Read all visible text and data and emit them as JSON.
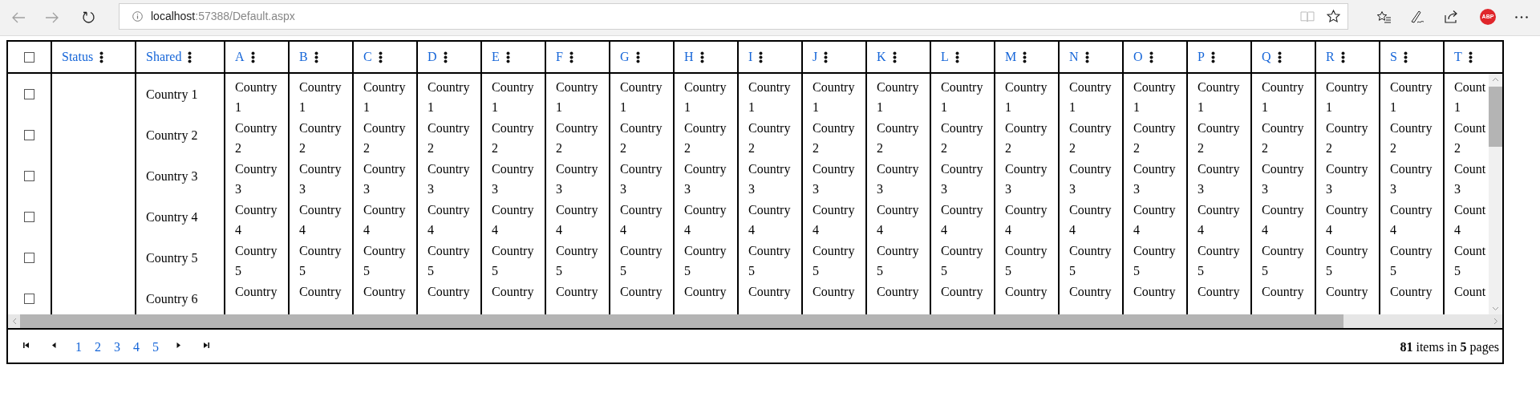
{
  "browser": {
    "url_host": "localhost",
    "url_path": ":57388/Default.aspx",
    "badge": "ABP"
  },
  "grid": {
    "select_all": {
      "checked": false
    },
    "columns": [
      {
        "label": "Status"
      },
      {
        "label": "Shared"
      },
      {
        "label": "A"
      },
      {
        "label": "B"
      },
      {
        "label": "C"
      },
      {
        "label": "D"
      },
      {
        "label": "E"
      },
      {
        "label": "F"
      },
      {
        "label": "G"
      },
      {
        "label": "H"
      },
      {
        "label": "I"
      },
      {
        "label": "J"
      },
      {
        "label": "K"
      },
      {
        "label": "L"
      },
      {
        "label": "M"
      },
      {
        "label": "N"
      },
      {
        "label": "O"
      },
      {
        "label": "P"
      },
      {
        "label": "Q"
      },
      {
        "label": "R"
      },
      {
        "label": "S"
      },
      {
        "label": "T"
      }
    ],
    "rows": [
      {
        "checked": false,
        "cells": [
          "",
          "Country 1",
          "Country 1",
          "Country 1",
          "Country 1",
          "Country 1",
          "Country 1",
          "Country 1",
          "Country 1",
          "Country 1",
          "Country 1",
          "Country 1",
          "Country 1",
          "Country 1",
          "Country 1",
          "Country 1",
          "Country 1",
          "Country 1",
          "Country 1",
          "Country 1",
          "Country 1",
          "Count 1"
        ]
      },
      {
        "checked": false,
        "cells": [
          "",
          "Country 2",
          "Country 2",
          "Country 2",
          "Country 2",
          "Country 2",
          "Country 2",
          "Country 2",
          "Country 2",
          "Country 2",
          "Country 2",
          "Country 2",
          "Country 2",
          "Country 2",
          "Country 2",
          "Country 2",
          "Country 2",
          "Country 2",
          "Country 2",
          "Country 2",
          "Country 2",
          "Count 2"
        ]
      },
      {
        "checked": false,
        "cells": [
          "",
          "Country 3",
          "Country 3",
          "Country 3",
          "Country 3",
          "Country 3",
          "Country 3",
          "Country 3",
          "Country 3",
          "Country 3",
          "Country 3",
          "Country 3",
          "Country 3",
          "Country 3",
          "Country 3",
          "Country 3",
          "Country 3",
          "Country 3",
          "Country 3",
          "Country 3",
          "Country 3",
          "Count 3"
        ]
      },
      {
        "checked": false,
        "cells": [
          "",
          "Country 4",
          "Country 4",
          "Country 4",
          "Country 4",
          "Country 4",
          "Country 4",
          "Country 4",
          "Country 4",
          "Country 4",
          "Country 4",
          "Country 4",
          "Country 4",
          "Country 4",
          "Country 4",
          "Country 4",
          "Country 4",
          "Country 4",
          "Country 4",
          "Country 4",
          "Country 4",
          "Count 4"
        ]
      },
      {
        "checked": false,
        "cells": [
          "",
          "Country 5",
          "Country 5",
          "Country 5",
          "Country 5",
          "Country 5",
          "Country 5",
          "Country 5",
          "Country 5",
          "Country 5",
          "Country 5",
          "Country 5",
          "Country 5",
          "Country 5",
          "Country 5",
          "Country 5",
          "Country 5",
          "Country 5",
          "Country 5",
          "Country 5",
          "Country 5",
          "Count 5"
        ]
      },
      {
        "checked": false,
        "cells": [
          "",
          "Country 6",
          "Country",
          "Country",
          "Country",
          "Country",
          "Country",
          "Country",
          "Country",
          "Country",
          "Country",
          "Country",
          "Country",
          "Country",
          "Country",
          "Country",
          "Country",
          "Country",
          "Country",
          "Country",
          "Country",
          "Count"
        ]
      }
    ],
    "pager": {
      "pages": [
        "1",
        "2",
        "3",
        "4",
        "5"
      ],
      "summary": "**81** items in **5** pages"
    }
  }
}
